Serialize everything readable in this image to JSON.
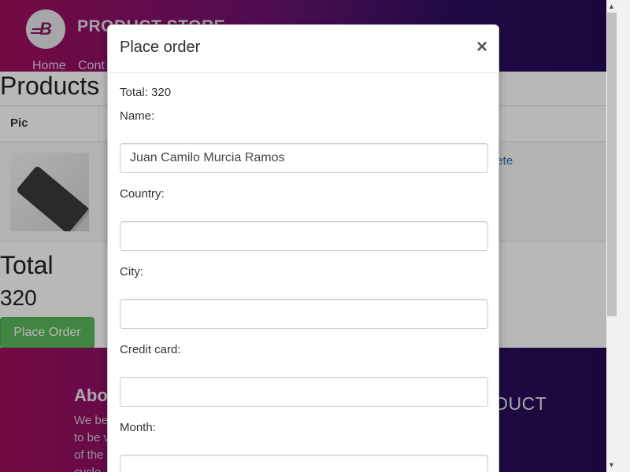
{
  "navbar": {
    "brand": "PRODUCT STORE",
    "logo_letter": "B",
    "links": [
      "Home",
      "Cont"
    ]
  },
  "cart": {
    "title": "Products",
    "column_pic": "Pic",
    "delete_link": "lete",
    "total_title": "Total",
    "total_value": "320",
    "place_order": "Place Order"
  },
  "footer": {
    "about_title": "Abo",
    "about_lines": [
      "We be",
      "to be v",
      "of the",
      "cycle"
    ],
    "product": "ODUCT"
  },
  "modal": {
    "title": "Place order",
    "close": "×",
    "total": "Total: 320",
    "fields": [
      {
        "label": "Name:",
        "value": "Juan Camilo Murcia Ramos"
      },
      {
        "label": "Country:",
        "value": ""
      },
      {
        "label": "City:",
        "value": ""
      },
      {
        "label": "Credit card:",
        "value": ""
      },
      {
        "label": "Month:",
        "value": ""
      }
    ]
  },
  "colors": {
    "gradient_start": "#a30f5d",
    "gradient_end": "#220b55",
    "success": "#5cb85c",
    "link": "#2a6db0"
  }
}
